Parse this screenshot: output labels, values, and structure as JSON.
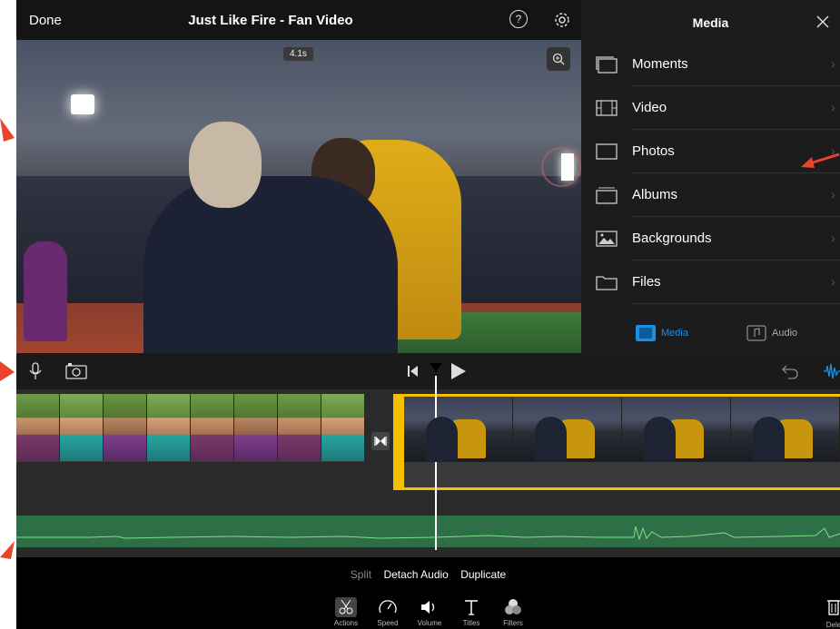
{
  "topbar": {
    "done_label": "Done",
    "project_title": "Just Like Fire - Fan Video",
    "help_label": "?"
  },
  "preview": {
    "duration_badge": "4.1s"
  },
  "media_panel": {
    "title": "Media",
    "items": [
      {
        "label": "Moments",
        "icon": "moments-icon"
      },
      {
        "label": "Video",
        "icon": "film-icon"
      },
      {
        "label": "Photos",
        "icon": "photos-icon"
      },
      {
        "label": "Albums",
        "icon": "albums-icon"
      },
      {
        "label": "Backgrounds",
        "icon": "backgrounds-icon"
      },
      {
        "label": "Files",
        "icon": "folder-icon"
      }
    ],
    "tabs": [
      {
        "label": "Media",
        "selected": true
      },
      {
        "label": "Audio",
        "selected": false
      }
    ],
    "chevron": "›"
  },
  "bottom": {
    "actions": [
      "Split",
      "Detach Audio",
      "Duplicate"
    ],
    "tools": [
      {
        "label": "Actions",
        "selected": true
      },
      {
        "label": "Speed",
        "selected": false
      },
      {
        "label": "Volume",
        "selected": false
      },
      {
        "label": "Titles",
        "selected": false
      },
      {
        "label": "Filters",
        "selected": false
      }
    ],
    "delete_label": "Dele"
  },
  "colors": {
    "accent_yellow": "#f6c000",
    "accent_blue": "#1a8fe3",
    "audio_green": "#2f6f45",
    "annotation_red": "#e8452a"
  }
}
